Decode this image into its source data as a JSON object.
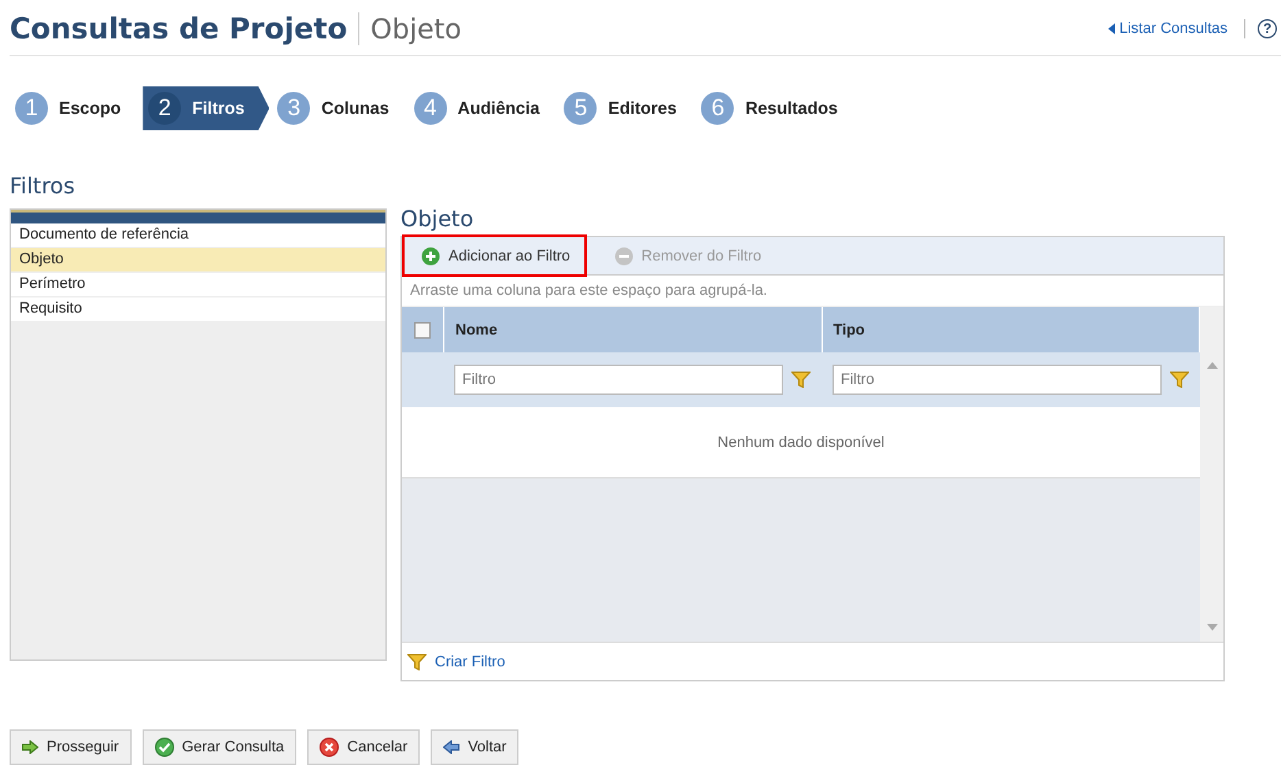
{
  "header": {
    "title": "Consultas de Projeto",
    "subtitle": "Objeto",
    "link": "Listar Consultas",
    "help": "?"
  },
  "steps": [
    {
      "number": "1",
      "label": "Escopo",
      "selected": false
    },
    {
      "number": "2",
      "label": "Filtros",
      "selected": true
    },
    {
      "number": "3",
      "label": "Colunas",
      "selected": false
    },
    {
      "number": "4",
      "label": "Audiência",
      "selected": false
    },
    {
      "number": "5",
      "label": "Editores",
      "selected": false
    },
    {
      "number": "6",
      "label": "Resultados",
      "selected": false
    }
  ],
  "section_title": "Filtros",
  "filter_list": [
    {
      "label": "Documento de referência",
      "selected": false
    },
    {
      "label": "Objeto",
      "selected": true
    },
    {
      "label": "Perímetro",
      "selected": false
    },
    {
      "label": "Requisito",
      "selected": false
    }
  ],
  "panel": {
    "title": "Objeto",
    "toolbar": [
      {
        "kind": "add",
        "label": "Adicionar ao Filtro",
        "disabled": false,
        "highlighted": true
      },
      {
        "kind": "remove",
        "label": "Remover do Filtro",
        "disabled": true,
        "highlighted": false
      }
    ],
    "group_hint": "Arraste uma coluna para este espaço para agrupá-la.",
    "columns": [
      {
        "label": "Nome",
        "filter_placeholder": "Filtro"
      },
      {
        "label": "Tipo",
        "filter_placeholder": "Filtro"
      }
    ],
    "select_all_checked": false,
    "empty_message": "Nenhum dado disponível",
    "footer_link": "Criar Filtro"
  },
  "buttons": [
    {
      "kind": "next",
      "label": "Prosseguir"
    },
    {
      "kind": "generate",
      "label": "Gerar Consulta"
    },
    {
      "kind": "cancel",
      "label": "Cancelar"
    },
    {
      "kind": "back",
      "label": "Voltar"
    }
  ]
}
